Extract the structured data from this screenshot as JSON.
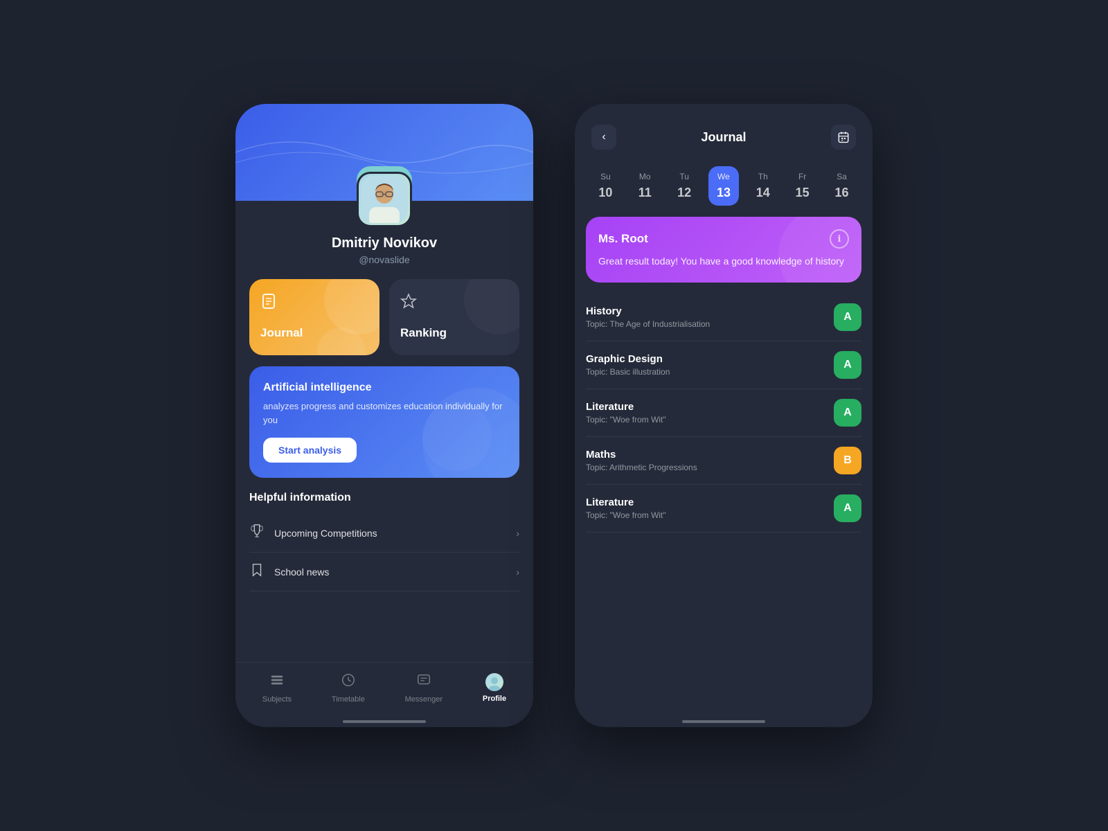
{
  "app": {
    "bg_color": "#1e2330"
  },
  "left_phone": {
    "profile": {
      "name": "Dmitriy Novikov",
      "handle": "@novaslide"
    },
    "cards": {
      "journal_label": "Journal",
      "ranking_label": "Ranking"
    },
    "ai_banner": {
      "title": "Artificial intelligence",
      "description": "analyzes progress and customizes education individually for you",
      "button_label": "Start analysis"
    },
    "helpful": {
      "title": "Helpful information",
      "items": [
        {
          "label": "Upcoming Competitions",
          "icon": "🏆"
        },
        {
          "label": "School news",
          "icon": "🔖"
        }
      ]
    },
    "bottom_nav": {
      "items": [
        {
          "label": "Subjects",
          "icon": "☰",
          "active": false
        },
        {
          "label": "Timetable",
          "icon": "🕐",
          "active": false
        },
        {
          "label": "Messenger",
          "icon": "💬",
          "active": false
        },
        {
          "label": "Profile",
          "icon": "👤",
          "active": true
        }
      ]
    }
  },
  "right_phone": {
    "header": {
      "title": "Journal",
      "back_label": "‹",
      "calendar_icon": "📅"
    },
    "week": {
      "days": [
        {
          "name": "Su",
          "num": "10",
          "active": false
        },
        {
          "name": "Mo",
          "num": "11",
          "active": false
        },
        {
          "name": "Tu",
          "num": "12",
          "active": false
        },
        {
          "name": "We",
          "num": "13",
          "active": true
        },
        {
          "name": "Th",
          "num": "14",
          "active": false
        },
        {
          "name": "Fr",
          "num": "15",
          "active": false
        },
        {
          "name": "Sa",
          "num": "16",
          "active": false
        }
      ]
    },
    "teacher_card": {
      "teacher_name": "Ms. Root",
      "message": "Great result today! You have a good knowledge of history",
      "info_icon": "ℹ"
    },
    "subjects": [
      {
        "name": "History",
        "topic": "Topic: The Age of Industrialisation",
        "grade": "A",
        "grade_type": "green"
      },
      {
        "name": "Graphic Design",
        "topic": "Topic: Basic illustration",
        "grade": "A",
        "grade_type": "green"
      },
      {
        "name": "Literature",
        "topic": "Topic: \"Woe from Wit\"",
        "grade": "A",
        "grade_type": "green"
      },
      {
        "name": "Maths",
        "topic": "Topic: Arithmetic Progressions",
        "grade": "B",
        "grade_type": "orange"
      },
      {
        "name": "Literature",
        "topic": "Topic: \"Woe from Wit\"",
        "grade": "A",
        "grade_type": "green"
      }
    ]
  }
}
